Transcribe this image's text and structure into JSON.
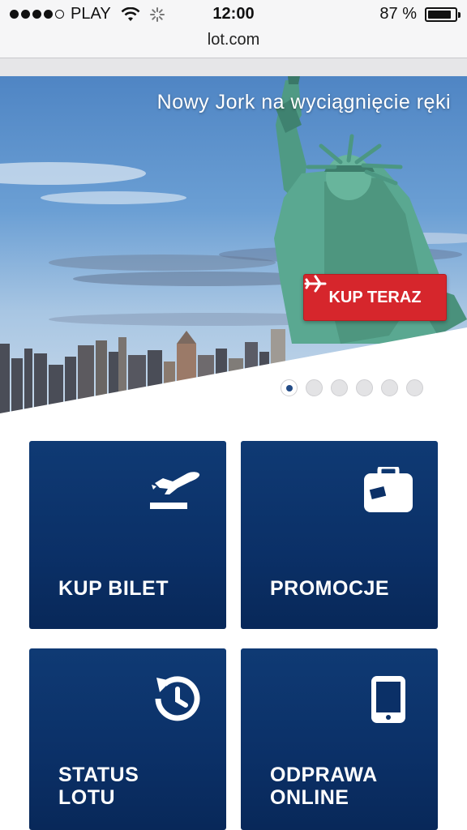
{
  "status_bar": {
    "carrier": "PLAY",
    "time": "12:00",
    "battery_percent": "87 %",
    "battery_level": 0.87
  },
  "browser": {
    "url": "lot.com"
  },
  "hero": {
    "title": "Nowy Jork na wyciągnięcie ręki",
    "cta_label": "KUP TERAZ",
    "slides_count": 6,
    "active_slide": 1
  },
  "tiles": [
    {
      "label": "KUP BILET",
      "icon": "plane-departure-icon"
    },
    {
      "label": "PROMOCJE",
      "icon": "suitcase-icon"
    },
    {
      "label_line1": "STATUS",
      "label_line2": "LOTU",
      "icon": "history-clock-icon"
    },
    {
      "label_line1": "ODPRAWA",
      "label_line2": "ONLINE",
      "icon": "mobile-phone-icon"
    }
  ],
  "colors": {
    "tile_blue": "#0b3067",
    "cta_red": "#d6262c"
  }
}
